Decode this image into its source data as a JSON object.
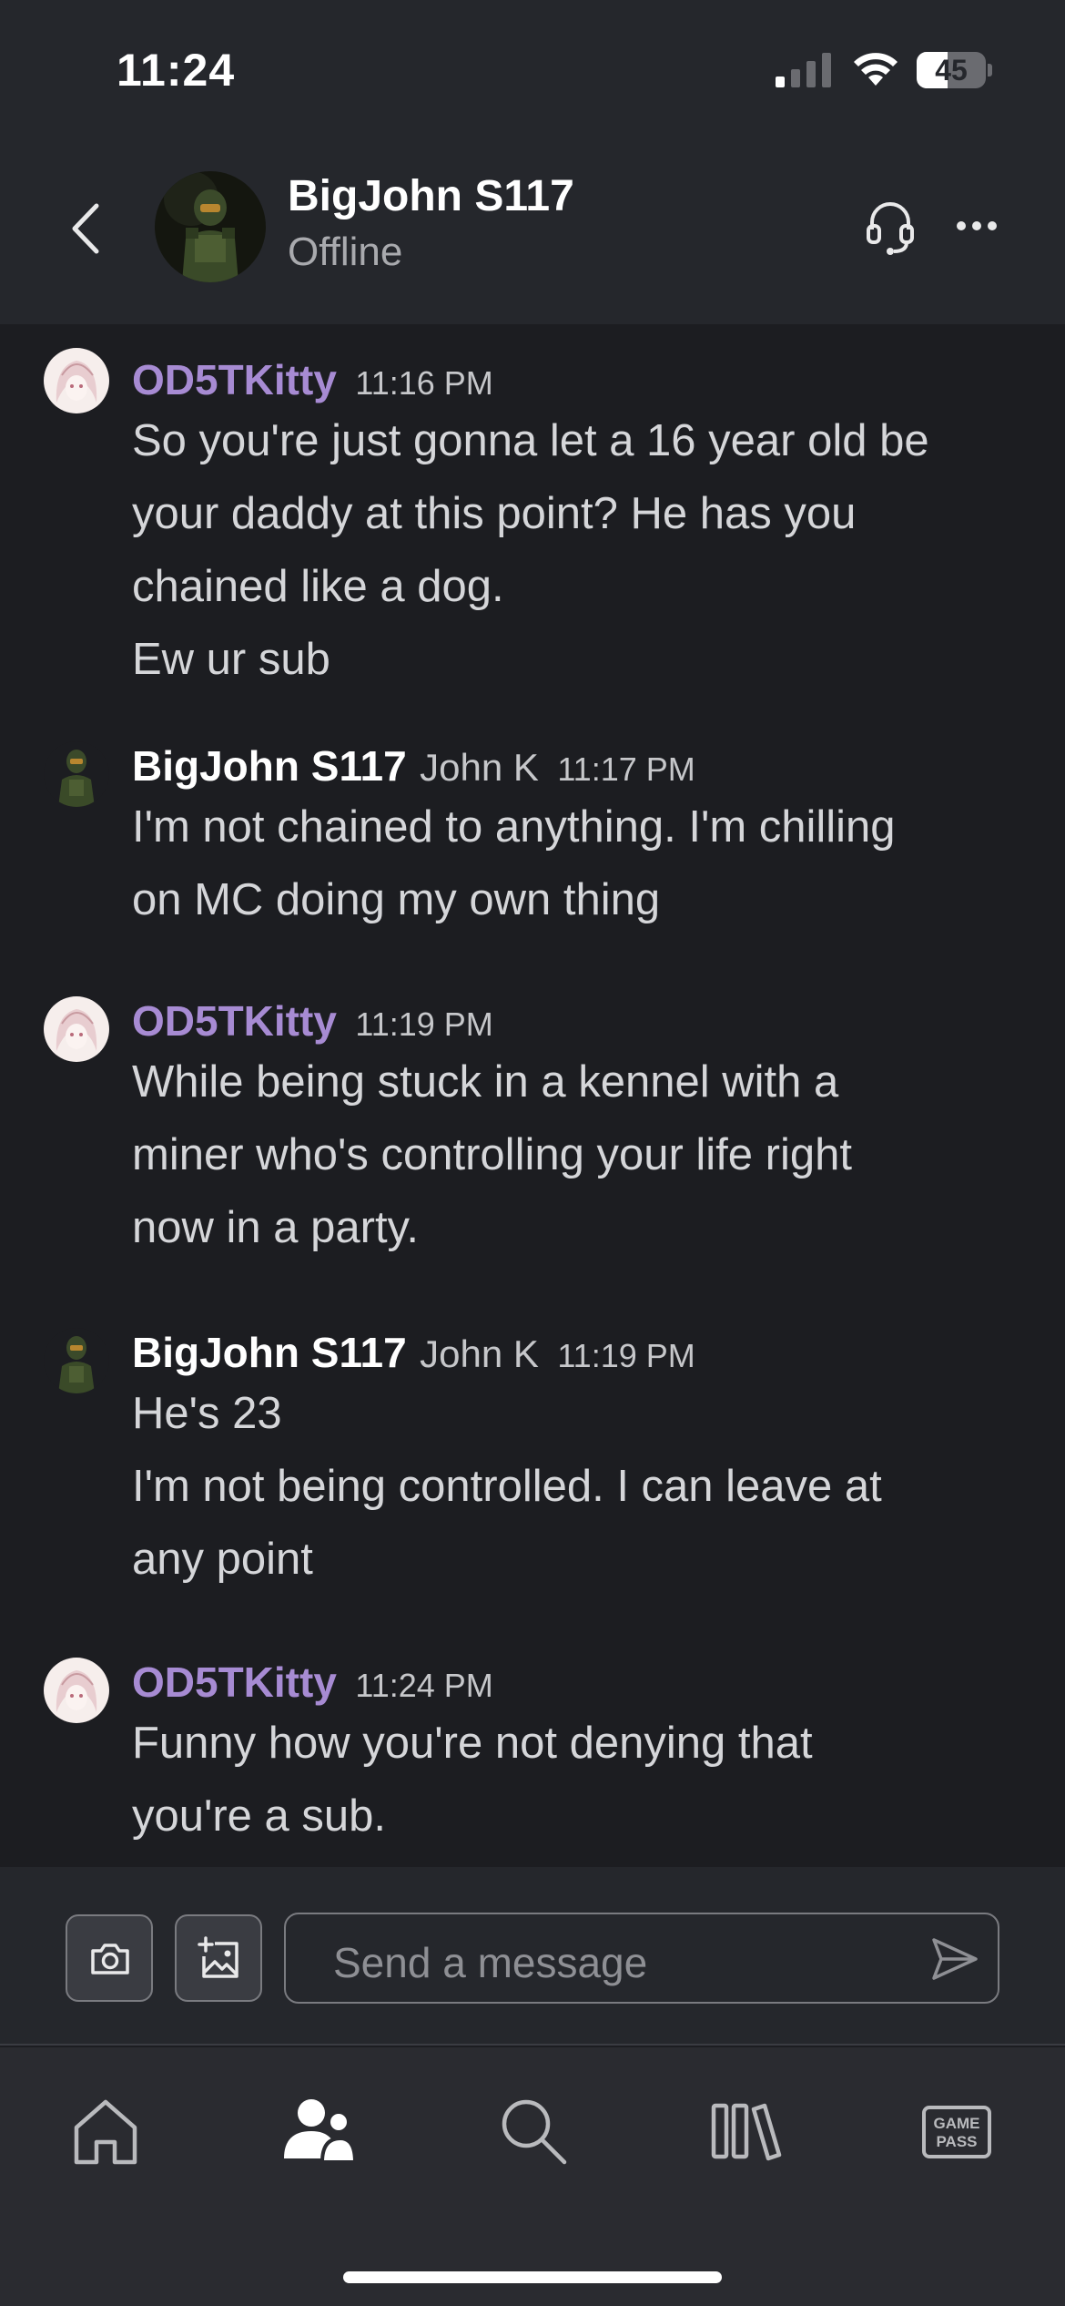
{
  "status_bar": {
    "time": "11:24",
    "battery_level": "45",
    "battery_fraction": 0.45
  },
  "header": {
    "contact_name": "BigJohn S117",
    "contact_status": "Offline",
    "back_icon": "chevron-left-icon",
    "call_icon": "headset-icon",
    "more_icon": "more-horizontal-icon"
  },
  "messages": [
    {
      "sender": "OD5TKitty",
      "real_name": "",
      "time": "11:16 PM",
      "lines": [
        "So you're just gonna let a 16 year old be",
        "your daddy at this point? He has you",
        "chained like a dog.",
        "Ew ur sub"
      ]
    },
    {
      "sender": "BigJohn S117",
      "real_name": "John K",
      "time": "11:17 PM",
      "lines": [
        "I'm not chained to anything. I'm chilling",
        "on MC doing my own thing"
      ]
    },
    {
      "sender": "OD5TKitty",
      "real_name": "",
      "time": "11:19 PM",
      "lines": [
        "While being stuck in a kennel with a",
        "miner who's controlling your life right",
        "now in a party."
      ]
    },
    {
      "sender": "BigJohn S117",
      "real_name": "John K",
      "time": "11:19 PM",
      "lines": [
        "He's 23",
        "I'm not being controlled. I can leave at",
        "any point"
      ]
    },
    {
      "sender": "OD5TKitty",
      "real_name": "",
      "time": "11:24 PM",
      "lines": [
        "Funny how you're not denying that",
        "you're a sub."
      ]
    }
  ],
  "composer": {
    "placeholder": "Send a message",
    "camera_icon": "camera-icon",
    "image_icon": "add-image-icon",
    "send_icon": "send-icon"
  },
  "nav": {
    "items": [
      {
        "name": "home",
        "icon": "home-icon"
      },
      {
        "name": "friends",
        "icon": "friends-icon",
        "active": true
      },
      {
        "name": "search",
        "icon": "search-icon"
      },
      {
        "name": "library",
        "icon": "library-icon"
      },
      {
        "name": "game-pass",
        "icon": "game-pass-icon",
        "label_line1": "GAME",
        "label_line2": "PASS"
      }
    ]
  },
  "colors": {
    "background": "#1c1d21",
    "header": "#25272c",
    "kitty_name": "#a78bd3",
    "text": "#d5d6d9",
    "muted": "#a9aaae"
  }
}
